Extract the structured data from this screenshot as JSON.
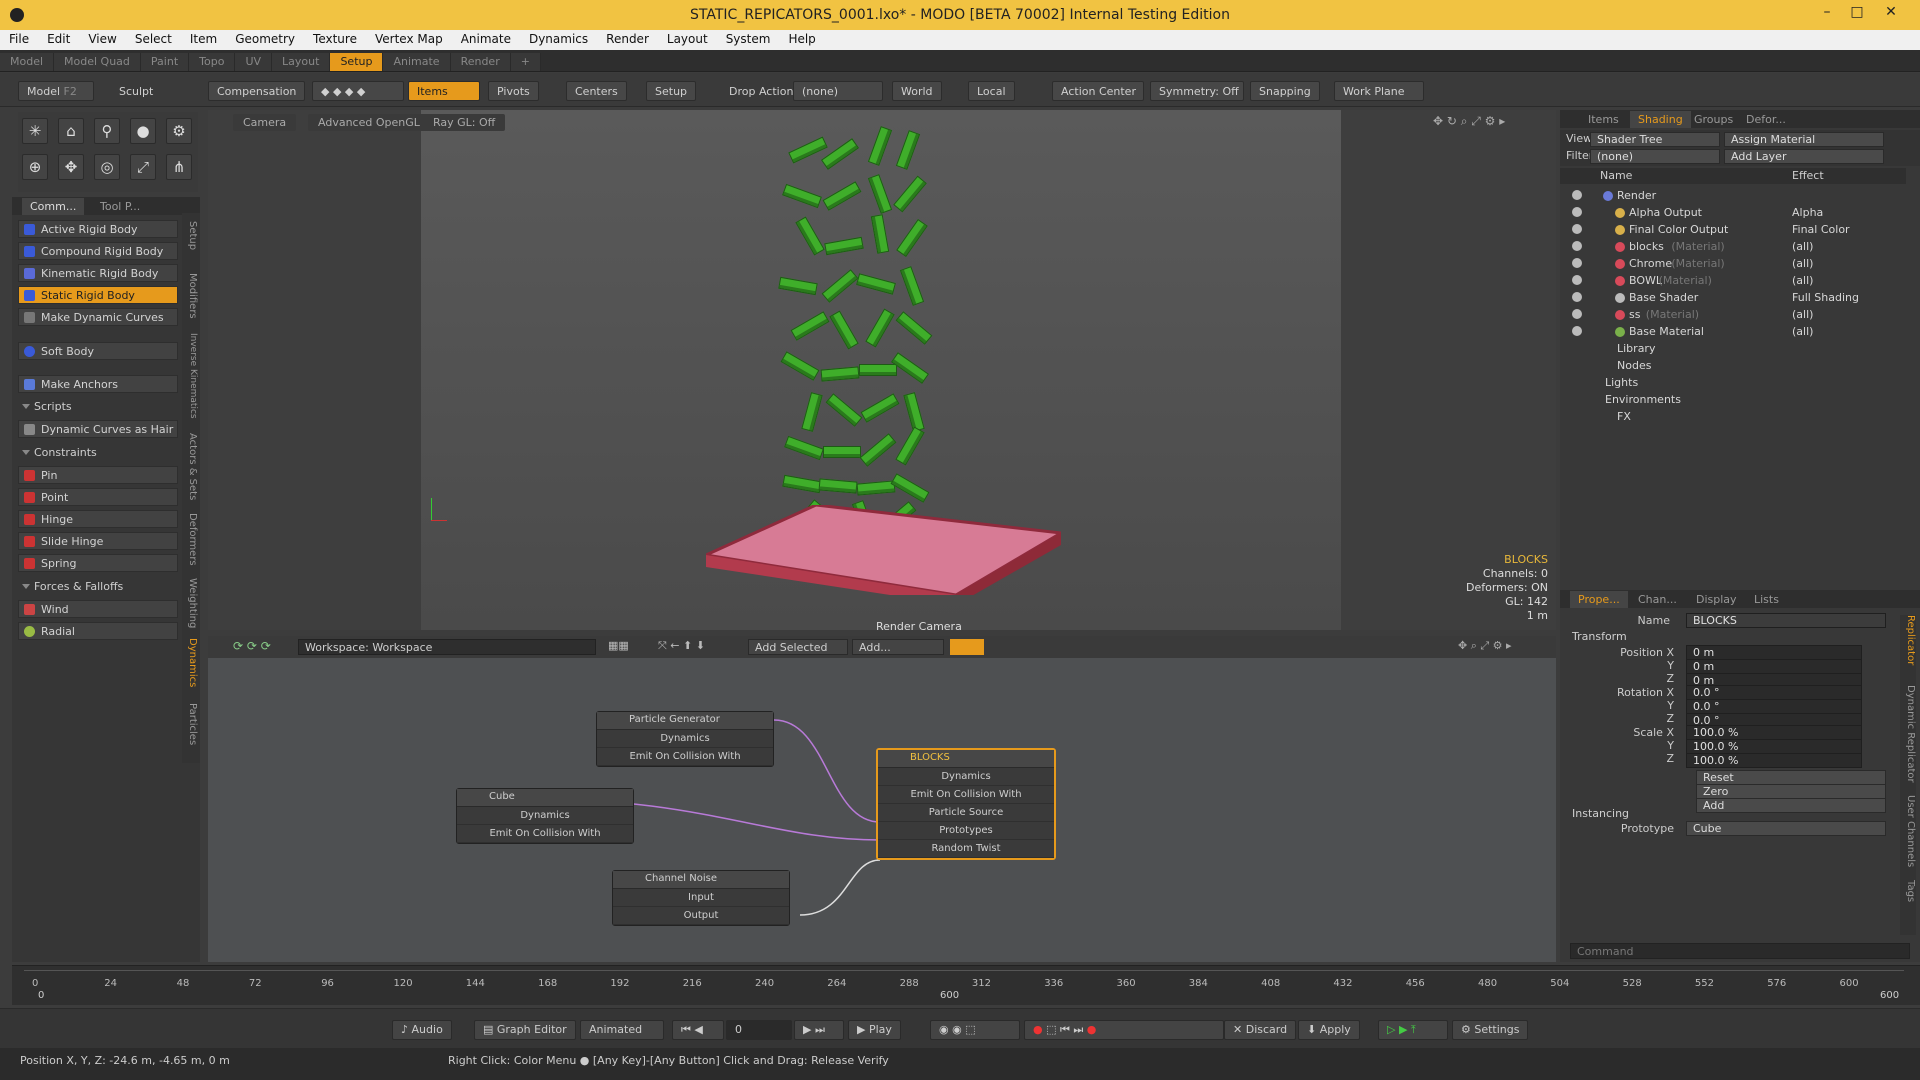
{
  "window": {
    "title": "STATIC_REPICATORS_0001.lxo* - MODO [BETA 70002] Internal Testing Edition"
  },
  "menu": [
    "File",
    "Edit",
    "View",
    "Select",
    "Item",
    "Geometry",
    "Texture",
    "Vertex Map",
    "Animate",
    "Dynamics",
    "Render",
    "Layout",
    "System",
    "Help"
  ],
  "layout_tabs": [
    "Model",
    "Model Quad",
    "Paint",
    "Topo",
    "UV",
    "Layout",
    "Setup",
    "Animate",
    "Render",
    "+"
  ],
  "toolbar": {
    "model": "Model",
    "f2": "F2",
    "sculpt": "Sculpt",
    "compensation": "Compensation",
    "items": "Items",
    "pivots": "Pivots",
    "centers": "Centers",
    "setup": "Setup",
    "drop_action": "Drop Action",
    "none": "(none)",
    "world": "World",
    "local": "Local",
    "action_center": "Action Center",
    "symmetry": "Symmetry: Off",
    "snapping": "Snapping",
    "work_plane": "Work Plane"
  },
  "left_tabs": [
    "Comm...",
    "Tool P..."
  ],
  "left_items": {
    "active_rigid": "Active Rigid Body",
    "compound_rigid": "Compound Rigid Body",
    "kinematic_rigid": "Kinematic Rigid Body",
    "static_rigid": "Static Rigid Body",
    "make_dynamic_curves": "Make Dynamic Curves",
    "soft_body": "Soft Body",
    "make_anchors": "Make Anchors",
    "scripts": "Scripts",
    "dyn_curves_hair": "Dynamic Curves as Hair",
    "constraints": "Constraints",
    "pin": "Pin",
    "point": "Point",
    "hinge": "Hinge",
    "slide_hinge": "Slide Hinge",
    "spring": "Spring",
    "forces": "Forces & Falloffs",
    "wind": "Wind",
    "radial": "Radial"
  },
  "left_vtabs": [
    "Setup",
    "Modifiers",
    "Inverse Kinematics",
    "Actors & Sets",
    "Deformers",
    "Weighting",
    "Dynamics",
    "Particles"
  ],
  "viewport": {
    "camera": "Camera",
    "gl": "Advanced OpenGL",
    "raygl": "Ray GL: Off",
    "render_camera": "Render Camera",
    "info_name": "BLOCKS",
    "info_channels": "Channels: 0",
    "info_deformers": "Deformers: ON",
    "info_gl": "GL: 142",
    "info_scale": "1 m"
  },
  "node_editor": {
    "workspace": "Workspace: Workspace",
    "add_selected": "Add Selected",
    "add": "Add...",
    "nodes": {
      "particle_generator": {
        "title": "Particle Generator",
        "rows": [
          "Dynamics",
          "Emit On Collision With"
        ]
      },
      "cube": {
        "title": "Cube",
        "rows": [
          "Dynamics",
          "Emit On Collision With"
        ]
      },
      "channel_noise": {
        "title": "Channel Noise",
        "rows": [
          "Input",
          "Output"
        ]
      },
      "blocks": {
        "title": "BLOCKS",
        "rows": [
          "Dynamics",
          "Emit On Collision With",
          "Particle Source",
          "Prototypes",
          "Random Twist"
        ]
      }
    }
  },
  "shading": {
    "tabs": [
      "Items",
      "Shading",
      "Groups",
      "Defor..."
    ],
    "view_label": "View",
    "view_value": "Shader Tree",
    "assign": "Assign Material",
    "filter_label": "Filter",
    "filter_value": "(none)",
    "add_layer": "Add Layer",
    "col_name": "Name",
    "col_effect": "Effect",
    "rows": [
      {
        "name": "Render",
        "sub": "",
        "effect": ""
      },
      {
        "name": "Alpha Output",
        "sub": "",
        "effect": "Alpha"
      },
      {
        "name": "Final Color Output",
        "sub": "",
        "effect": "Final Color"
      },
      {
        "name": "blocks",
        "sub": "(Material)",
        "effect": "(all)"
      },
      {
        "name": "Chrome",
        "sub": "(Material)",
        "effect": "(all)"
      },
      {
        "name": "BOWL",
        "sub": "(Material)",
        "effect": "(all)"
      },
      {
        "name": "Base Shader",
        "sub": "",
        "effect": "Full Shading"
      },
      {
        "name": "ss",
        "sub": "(Material)",
        "effect": "(all)"
      },
      {
        "name": "Base Material",
        "sub": "",
        "effect": "(all)"
      },
      {
        "name": "Library",
        "sub": "",
        "effect": ""
      },
      {
        "name": "Nodes",
        "sub": "",
        "effect": ""
      },
      {
        "name": "Lights",
        "sub": "",
        "effect": ""
      },
      {
        "name": "Environments",
        "sub": "",
        "effect": ""
      },
      {
        "name": "FX",
        "sub": "",
        "effect": ""
      }
    ]
  },
  "properties": {
    "tabs": [
      "Prope...",
      "Chan...",
      "Display",
      "Lists"
    ],
    "name_label": "Name",
    "name_value": "BLOCKS",
    "transform": "Transform",
    "position_x": "Position X",
    "y": "Y",
    "z": "Z",
    "rotation_x": "Rotation X",
    "scale_x": "Scale X",
    "pos": [
      "0 m",
      "0 m",
      "0 m"
    ],
    "rot": [
      "0.0 °",
      "0.0 °",
      "0.0 °"
    ],
    "scl": [
      "100.0 %",
      "100.0 %",
      "100.0 %"
    ],
    "reset": "Reset",
    "zero": "Zero",
    "add": "Add",
    "instancing": "Instancing",
    "prototype_label": "Prototype",
    "prototype_value": "Cube",
    "command": "Command",
    "vtabs": [
      "Replicator",
      "Dynamic Replicator",
      "User Channels",
      "Tags"
    ]
  },
  "timeline": {
    "ticks": [
      "0",
      "24",
      "48",
      "72",
      "96",
      "120",
      "144",
      "168",
      "192",
      "216",
      "240",
      "264",
      "288",
      "312",
      "336",
      "360",
      "384",
      "408",
      "432",
      "456",
      "480",
      "504",
      "528",
      "552",
      "576",
      "600"
    ],
    "start": "0",
    "end": "600",
    "end2": "600"
  },
  "transport": {
    "audio": "Audio",
    "graph": "Graph Editor",
    "animated": "Animated",
    "frame": "0",
    "play": "Play",
    "discard": "Discard",
    "apply": "Apply",
    "settings": "Settings"
  },
  "status": {
    "position": "Position X, Y, Z:  -24.6 m, -4.65 m, 0 m",
    "hint": "Right Click: Color Menu ● [Any Key]-[Any Button] Click and Drag: Release Verify"
  }
}
